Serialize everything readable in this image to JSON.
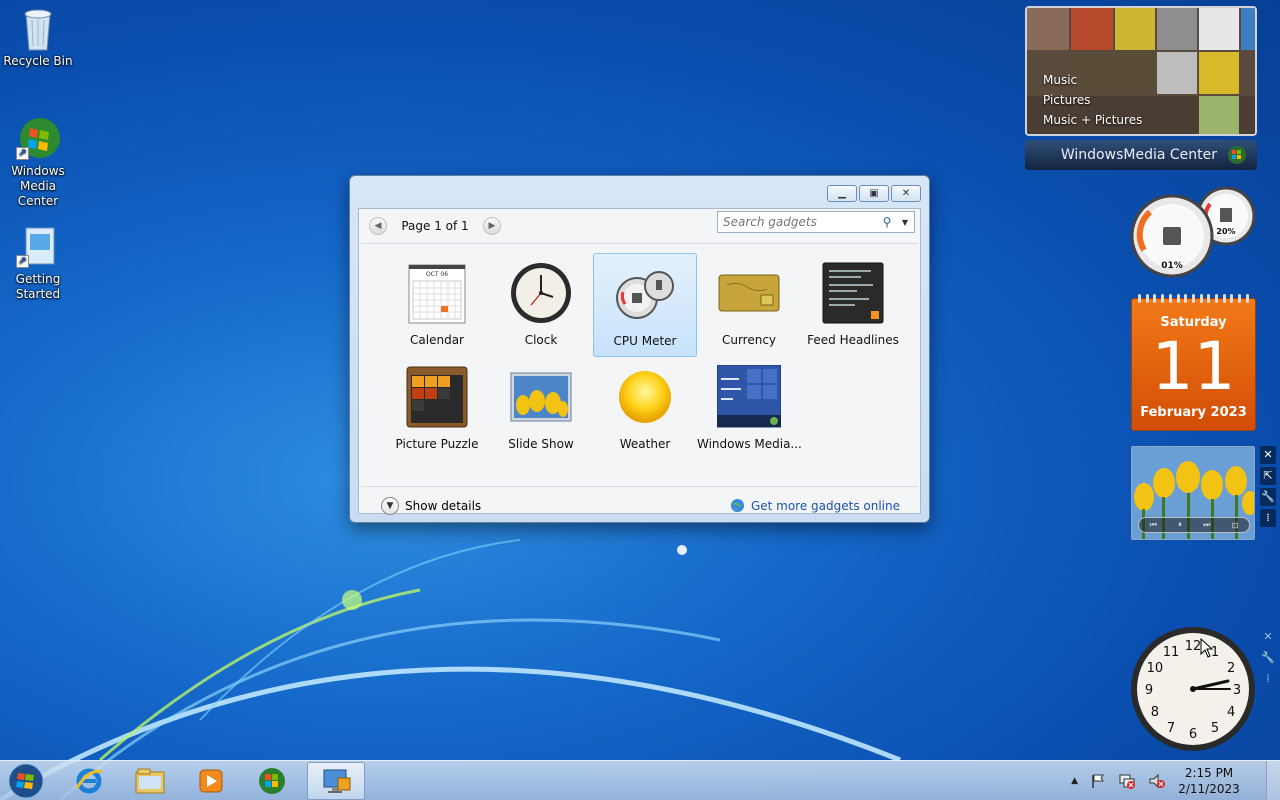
{
  "desktop": {
    "icons": [
      {
        "label": "Recycle Bin",
        "icon": "recycle-bin-icon"
      },
      {
        "label": "Windows\nMedia Center",
        "icon": "windows-media-center-icon"
      },
      {
        "label": "Getting\nStarted",
        "icon": "getting-started-icon"
      }
    ]
  },
  "gadgets_window": {
    "pager_label": "Page 1 of 1",
    "search_placeholder": "Search gadgets",
    "items": [
      {
        "label": "Calendar",
        "icon": "calendar-icon",
        "selected": false
      },
      {
        "label": "Clock",
        "icon": "clock-icon",
        "selected": false
      },
      {
        "label": "CPU Meter",
        "icon": "cpu-meter-icon",
        "selected": true
      },
      {
        "label": "Currency",
        "icon": "currency-icon",
        "selected": false
      },
      {
        "label": "Feed Headlines",
        "icon": "feed-headlines-icon",
        "selected": false
      },
      {
        "label": "Picture Puzzle",
        "icon": "picture-puzzle-icon",
        "selected": false
      },
      {
        "label": "Slide Show",
        "icon": "slide-show-icon",
        "selected": false
      },
      {
        "label": "Weather",
        "icon": "weather-icon",
        "selected": false
      },
      {
        "label": "Windows Media...",
        "icon": "windows-media-center-gadget-icon",
        "selected": false
      }
    ],
    "show_details_label": "Show details",
    "get_more_label": "Get more gadgets online",
    "calendar_thumb_month": "OCT 06"
  },
  "wmc_gadget": {
    "menu": [
      "Music",
      "Pictures",
      "Music + Pictures"
    ],
    "title_a": "Windows",
    "title_b": " Media Center"
  },
  "cpu_gadget": {
    "cpu": "01%",
    "memory": "20%"
  },
  "calendar_gadget": {
    "weekday": "Saturday",
    "day": "11",
    "month_year": "February 2023"
  },
  "clock_gadget": {
    "numbers": [
      "12",
      "1",
      "2",
      "3",
      "4",
      "5",
      "6",
      "7",
      "8",
      "9",
      "10",
      "11"
    ]
  },
  "taskbar": {
    "time": "2:15 PM",
    "date": "2/11/2023"
  },
  "colors": {
    "accent": "#1a55b0",
    "calendar_orange": "#e86a10",
    "selection": "#c7e2fb"
  }
}
